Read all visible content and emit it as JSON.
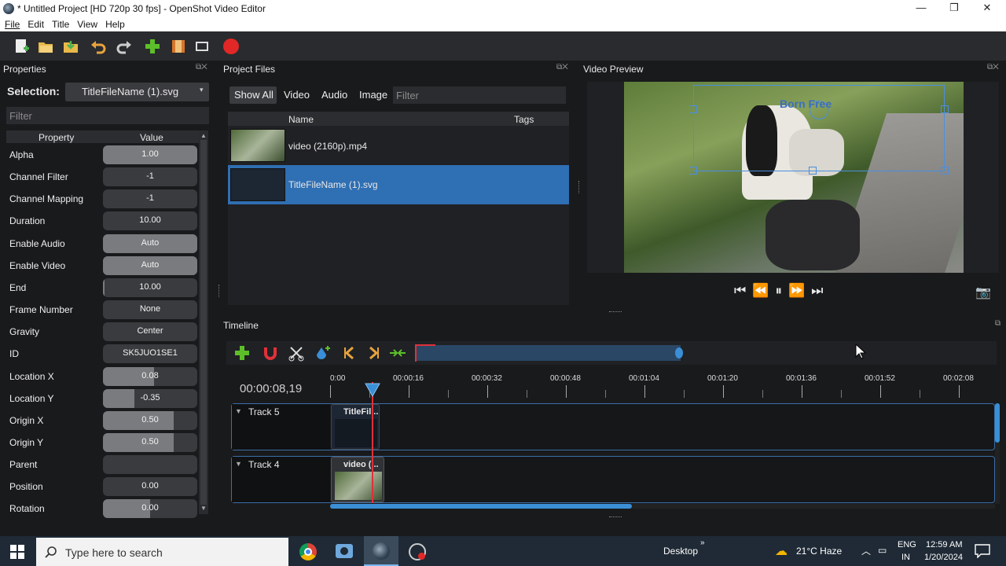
{
  "window": {
    "title": "* Untitled Project [HD 720p 30 fps] - OpenShot Video Editor",
    "controls": [
      "—",
      "❐",
      "✕"
    ]
  },
  "menu": [
    "File",
    "Edit",
    "Title",
    "View",
    "Help"
  ],
  "toolbar": {
    "icons": [
      "new-project-icon",
      "open-project-icon",
      "save-project-icon",
      "undo-icon",
      "redo-icon",
      "import-files-icon",
      "choose-profile-icon",
      "fullscreen-icon",
      "export-video-icon"
    ]
  },
  "properties": {
    "title": "Properties",
    "selection_label": "Selection:",
    "selection_value": "TitleFileName (1).svg",
    "filter_placeholder": "Filter",
    "col_property": "Property",
    "col_value": "Value",
    "rows": [
      {
        "name": "Alpha",
        "value": "1.00",
        "fill": 1.0
      },
      {
        "name": "Channel Filter",
        "value": "-1",
        "fill": 0
      },
      {
        "name": "Channel Mapping",
        "value": "-1",
        "fill": 0
      },
      {
        "name": "Duration",
        "value": "10.00",
        "fill": 0
      },
      {
        "name": "Enable Audio",
        "value": "Auto",
        "fill": 1.0
      },
      {
        "name": "Enable Video",
        "value": "Auto",
        "fill": 1.0
      },
      {
        "name": "End",
        "value": "10.00",
        "fill": 0.02
      },
      {
        "name": "Frame Number",
        "value": "None",
        "fill": 0
      },
      {
        "name": "Gravity",
        "value": "Center",
        "fill": 0
      },
      {
        "name": "ID",
        "value": "SK5JUO1SE1",
        "fill": 0
      },
      {
        "name": "Location X",
        "value": "0.08",
        "fill": 0.54
      },
      {
        "name": "Location Y",
        "value": "-0.35",
        "fill": 0.33
      },
      {
        "name": "Origin X",
        "value": "0.50",
        "fill": 0.75
      },
      {
        "name": "Origin Y",
        "value": "0.50",
        "fill": 0.75
      },
      {
        "name": "Parent",
        "value": "",
        "fill": 0
      },
      {
        "name": "Position",
        "value": "0.00",
        "fill": 0
      },
      {
        "name": "Rotation",
        "value": "0.00",
        "fill": 0.5
      }
    ]
  },
  "project_files": {
    "title": "Project Files",
    "tabs": [
      "Show All",
      "Video",
      "Audio",
      "Image"
    ],
    "filter_placeholder": "Filter",
    "col_name": "Name",
    "col_tags": "Tags",
    "files": [
      {
        "name": "video (2160p).mp4",
        "selected": false
      },
      {
        "name": "TitleFileName (1).svg",
        "selected": true
      }
    ]
  },
  "preview": {
    "title": "Video Preview",
    "overlay_text": "Born Free"
  },
  "timeline": {
    "title": "Timeline",
    "current_time": "00:00:08,19",
    "ruler": [
      "0:00",
      "00:00:16",
      "00:00:32",
      "00:00:48",
      "00:01:04",
      "00:01:20",
      "00:01:36",
      "00:01:52",
      "00:02:08"
    ],
    "tracks": [
      {
        "name": "Track 5",
        "clip": "TitleFil..."
      },
      {
        "name": "Track 4",
        "clip": "video (..."
      }
    ]
  },
  "taskbar": {
    "search_placeholder": "Type here to search",
    "desktop": "Desktop",
    "weather": "21°C  Haze",
    "lang1": "ENG",
    "lang2": "IN",
    "time": "12:59 AM",
    "date": "1/20/2024"
  },
  "colors": {
    "selection": "#2f6fb3",
    "playhead": "#e0313a",
    "accent": "#3a8fd6"
  }
}
